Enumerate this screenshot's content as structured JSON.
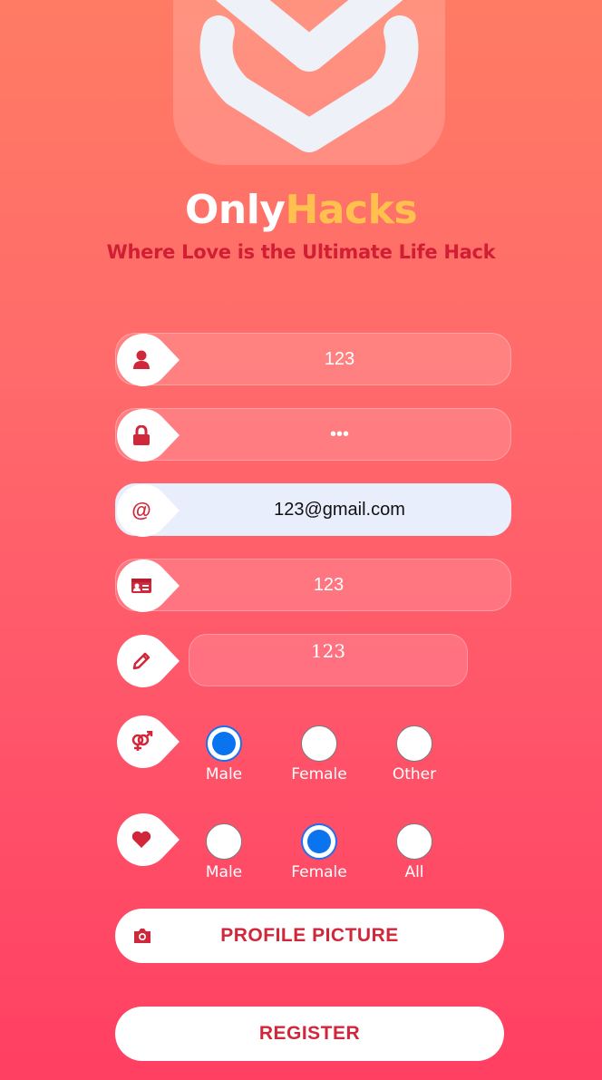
{
  "brand": {
    "part1": "Only",
    "part2": "Hacks",
    "tagline": "Where Love is the Ultimate Life Hack"
  },
  "fields": {
    "username": {
      "icon": "user-icon",
      "value": "123"
    },
    "password": {
      "icon": "lock-icon",
      "value": "•••"
    },
    "email": {
      "icon": "at-icon",
      "value": "123@gmail.com"
    },
    "id": {
      "icon": "id-card-icon",
      "value": "123"
    },
    "bio": {
      "icon": "pencil-icon",
      "value": "123"
    }
  },
  "gender": {
    "icon": "gender-icon",
    "options": [
      "Male",
      "Female",
      "Other"
    ],
    "selected": "Male"
  },
  "interest": {
    "icon": "heart-icon",
    "options": [
      "Male",
      "Female",
      "All"
    ],
    "selected": "Female"
  },
  "buttons": {
    "profile_picture": "PROFILE PICTURE",
    "register": "REGISTER"
  },
  "colors": {
    "accent": "#d0273a",
    "brand_hacks": "#ffc04d",
    "radio_on": "#0a74f0"
  }
}
